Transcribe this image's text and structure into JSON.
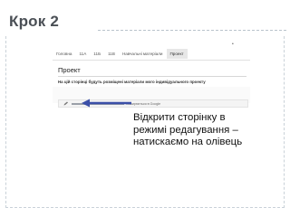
{
  "slide": {
    "title": "Крок 2",
    "instruction_lines": [
      "Відкрити сторінку в",
      "режимі редагування –",
      "натискаємо на олівець"
    ]
  },
  "screenshot": {
    "tabs": [
      {
        "label": "Головна",
        "active": false
      },
      {
        "label": "11А",
        "active": false
      },
      {
        "label": "11Б",
        "active": false
      },
      {
        "label": "11В",
        "active": false
      },
      {
        "label": "Навчальні матеріали",
        "active": false
      },
      {
        "label": "Проект",
        "active": true
      }
    ],
    "page_title": "Проект",
    "page_description": "На цій сторінці будуть розміщені матеріали мого індивідуального проекту",
    "toolbar": {
      "edit_icon": "pencil-icon",
      "hint_text": "поширюється в Google"
    }
  },
  "colors": {
    "title": "#4a4f55",
    "arrow": "#3b4fa8",
    "active_tab_bg": "#e7e7e7"
  }
}
